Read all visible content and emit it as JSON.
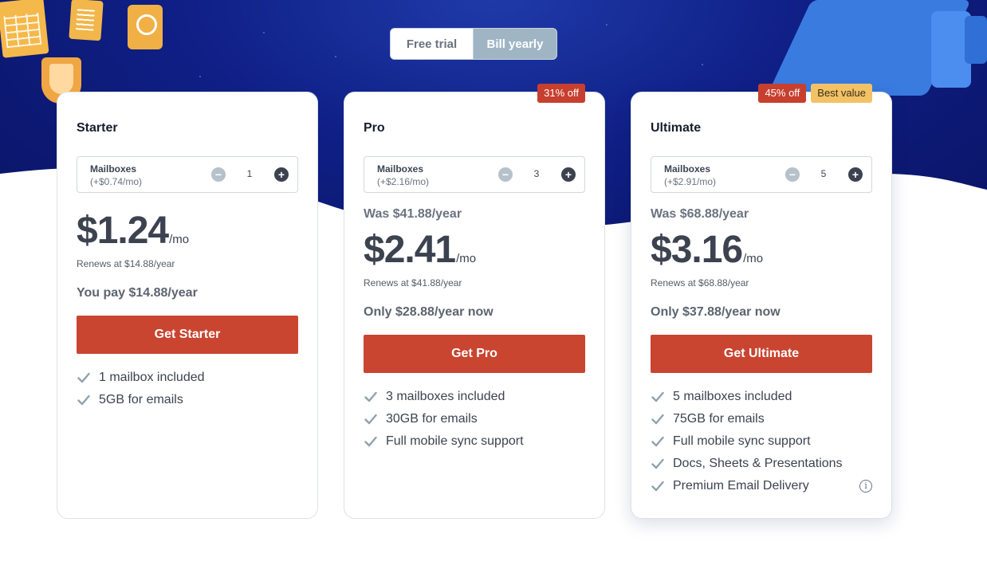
{
  "billing_toggle": {
    "free_trial": "Free trial",
    "bill_yearly": "Bill yearly",
    "selected": "Bill yearly"
  },
  "plans": [
    {
      "name": "Starter",
      "badges": [],
      "mailboxes_label": "Mailboxes",
      "mailboxes_extra": "(+$0.74/mo)",
      "quantity": "1",
      "was_price": "",
      "price": "$1.24",
      "per": "/mo",
      "renews": "Renews at $14.88/year",
      "pay_note": "You pay $14.88/year",
      "cta": "Get Starter",
      "features": [
        "1 mailbox included",
        "5GB for emails"
      ]
    },
    {
      "name": "Pro",
      "badges": [
        "31% off"
      ],
      "mailboxes_label": "Mailboxes",
      "mailboxes_extra": "(+$2.16/mo)",
      "quantity": "3",
      "was_price": "Was $41.88/year",
      "price": "$2.41",
      "per": "/mo",
      "renews": "Renews at $41.88/year",
      "pay_note": "Only $28.88/year now",
      "cta": "Get Pro",
      "features": [
        "3 mailboxes included",
        "30GB for emails",
        "Full mobile sync support"
      ]
    },
    {
      "name": "Ultimate",
      "badges": [
        "45% off",
        "Best value"
      ],
      "mailboxes_label": "Mailboxes",
      "mailboxes_extra": "(+$2.91/mo)",
      "quantity": "5",
      "was_price": "Was $68.88/year",
      "price": "$3.16",
      "per": "/mo",
      "renews": "Renews at $68.88/year",
      "pay_note": "Only $37.88/year now",
      "cta": "Get Ultimate",
      "features": [
        "5 mailboxes included",
        "75GB for emails",
        "Full mobile sync support",
        "Docs, Sheets & Presentations",
        "Premium Email Delivery"
      ]
    }
  ],
  "colors": {
    "hero_dark": "#0a1464",
    "hero_mid": "#0f1f86",
    "cta": "#c94530",
    "badge_off": "#c73f2e",
    "badge_best": "#f3c266",
    "toggle_selected": "#9fb5c4",
    "check": "#8fa3ad"
  },
  "icons": {
    "check": "check-icon",
    "minus": "minus-circle-icon",
    "plus": "plus-circle-icon",
    "info": "info-icon"
  }
}
